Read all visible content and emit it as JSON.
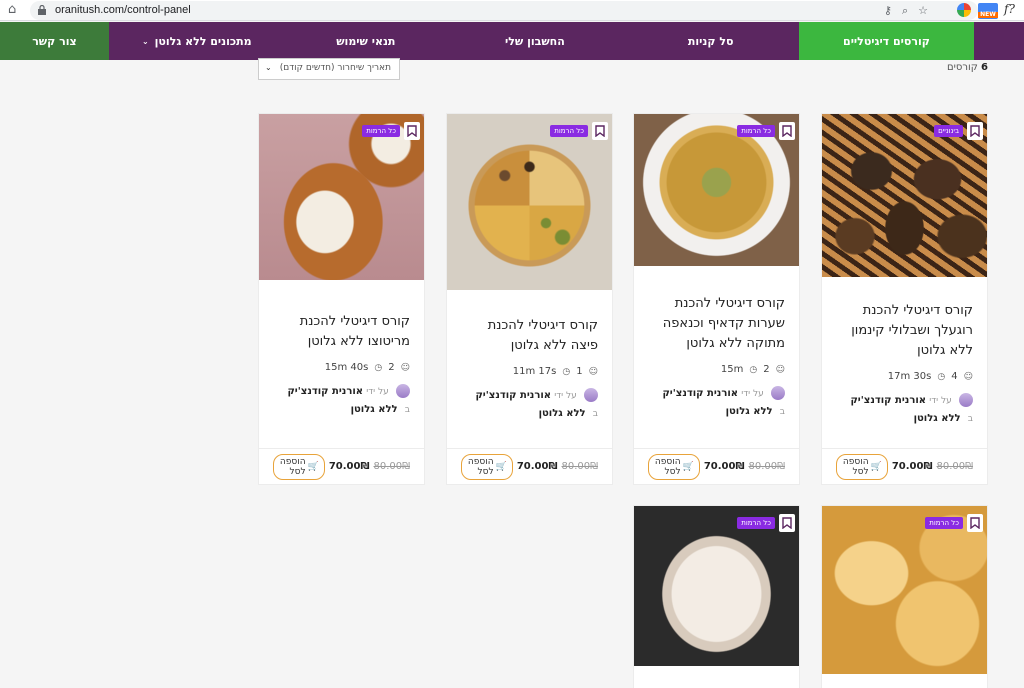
{
  "browser": {
    "url": "oranitush.com/control-panel",
    "ext_new": "NEW",
    "ext_fx": "f?"
  },
  "nav": {
    "items": [
      {
        "label": "קורסים דיגיטליים",
        "active": true
      },
      {
        "label": "סל קניות"
      },
      {
        "label": "החשבון שלי"
      },
      {
        "label": "תנאי שימוש"
      },
      {
        "label": "מתכונים ללא גלוטן",
        "dropdown": true
      },
      {
        "label": "צור קשר"
      }
    ],
    "colors": {
      "bar": "#5b2660",
      "active": "#3cb73f",
      "contact": "#3d7b3a"
    }
  },
  "listing": {
    "count_number": "6",
    "count_label": "קורסים",
    "sort_label": "תאריך שיחרור (חדשים קודם)"
  },
  "courses": [
    {
      "badge": "בינוניים",
      "title": "קורס דיגיטלי להכנת רוגעלך ושבלולי קינמון ללא גלוטן",
      "lessons": "4",
      "duration": "17m 30s",
      "by": "על ידי",
      "author": "אורנית קודנצ'יק",
      "in": "ב",
      "category": "ללא גלוטן",
      "old_price": "80.00₪",
      "price": "70.00₪",
      "cart": "הוספה לסל"
    },
    {
      "badge": "כל הרמות",
      "title": "קורס דיגיטלי להכנת שערות קדאיף וכנאפה מתוקה ללא גלוטן",
      "lessons": "2",
      "duration": "15m",
      "by": "על ידי",
      "author": "אורנית קודנצ'יק",
      "in": "ב",
      "category": "ללא גלוטן",
      "old_price": "80.00₪",
      "price": "70.00₪",
      "cart": "הוספה לסל"
    },
    {
      "badge": "כל הרמות",
      "title": "קורס דיגיטלי להכנת פיצה ללא גלוטן",
      "lessons": "1",
      "duration": "11m 17s",
      "by": "על ידי",
      "author": "אורנית קודנצ'יק",
      "in": "ב",
      "category": "ללא גלוטן",
      "old_price": "80.00₪",
      "price": "70.00₪",
      "cart": "הוספה לסל"
    },
    {
      "badge": "כל הרמות",
      "title": "קורס דיגיטלי להכנת מריטוצו ללא גלוטן",
      "lessons": "2",
      "duration": "15m 40s",
      "by": "על ידי",
      "author": "אורנית קודנצ'יק",
      "in": "ב",
      "category": "ללא גלוטן",
      "old_price": "80.00₪",
      "price": "70.00₪",
      "cart": "הוספה לסל"
    },
    {
      "badge": "כל הרמות"
    },
    {
      "badge": "כל הרמות"
    }
  ]
}
